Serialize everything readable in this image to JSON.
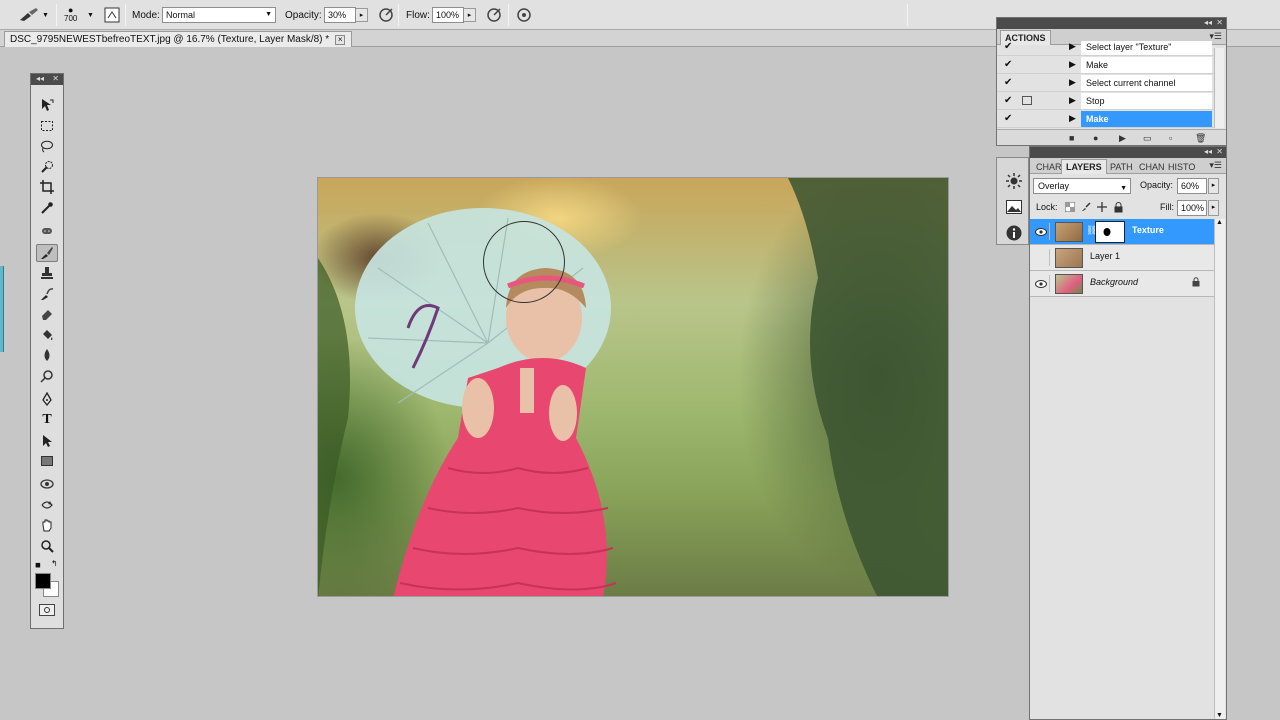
{
  "options_bar": {
    "brush_size": "700",
    "mode_label": "Mode:",
    "mode_value": "Normal",
    "opacity_label": "Opacity:",
    "opacity_value": "30%",
    "flow_label": "Flow:",
    "flow_value": "100%"
  },
  "document": {
    "tab_title": "DSC_9795NEWESTbefreoTEXT.jpg @ 16.7% (Texture, Layer Mask/8) *",
    "close_glyph": "×"
  },
  "actions_panel": {
    "tab_label": "ACTIONS",
    "steps": [
      {
        "label": "Select layer \"Texture\"",
        "checked": true,
        "selected": false
      },
      {
        "label": "Make",
        "checked": true,
        "selected": false
      },
      {
        "label": "Select current channel",
        "checked": true,
        "selected": false
      },
      {
        "label": "Stop",
        "checked": true,
        "selected": false
      },
      {
        "label": "Make",
        "checked": true,
        "selected": true
      }
    ]
  },
  "layers_panel": {
    "tabs": [
      "CHAR",
      "LAYERS",
      "PATH",
      "CHAN",
      "HISTO"
    ],
    "active_tab": "LAYERS",
    "blend_mode": "Overlay",
    "opacity_label": "Opacity:",
    "opacity_value": "60%",
    "lock_label": "Lock:",
    "fill_label": "Fill:",
    "fill_value": "100%",
    "layers": [
      {
        "name": "Texture",
        "visible": true,
        "selected": true,
        "has_mask": true
      },
      {
        "name": "Layer 1",
        "visible": false,
        "selected": false,
        "has_mask": false
      },
      {
        "name": "Background",
        "visible": true,
        "selected": false,
        "has_mask": false,
        "locked": true
      }
    ]
  },
  "colors": {
    "selection_blue": "#3399ff",
    "panel_bg": "#e2e2e2",
    "workspace_bg": "#c6c6c6",
    "panel_header": "#4b4b4b",
    "foreground_color": "#000000",
    "background_color": "#ffffff"
  },
  "icons": {
    "tools": [
      "move-icon",
      "marquee-icon",
      "lasso-icon",
      "quick-select-icon",
      "crop-icon",
      "eyedropper-icon",
      "healing-brush-icon",
      "brush-icon",
      "clone-stamp-icon",
      "history-brush-icon",
      "eraser-icon",
      "paint-bucket-icon",
      "blur-icon",
      "dodge-icon",
      "pen-icon",
      "type-icon",
      "path-select-icon",
      "rectangle-icon",
      "3d-rotate-icon",
      "3d-orbit-icon",
      "hand-icon",
      "zoom-icon"
    ]
  }
}
